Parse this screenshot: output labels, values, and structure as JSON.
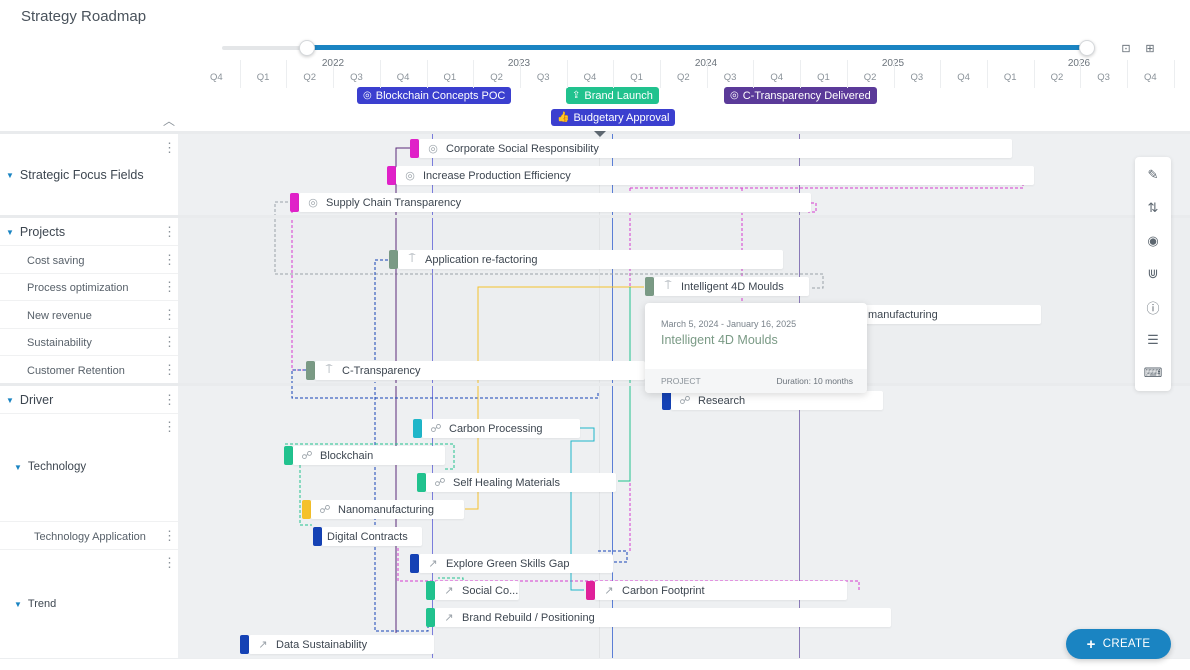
{
  "page": {
    "title": "Strategy Roadmap"
  },
  "slider": {
    "range_start": "2022 Q2",
    "range_end": "2026 Q2"
  },
  "header_tools": [
    {
      "name": "focus-icon",
      "glyph": "⊡"
    },
    {
      "name": "fit-view-icon",
      "glyph": "⊞"
    }
  ],
  "timeline": {
    "years": [
      "2022",
      "2023",
      "2024",
      "2025",
      "2026"
    ],
    "quarters": [
      "Q4",
      "Q1",
      "Q2",
      "Q3",
      "Q4",
      "Q1",
      "Q2",
      "Q3",
      "Q4",
      "Q1",
      "Q2",
      "Q3",
      "Q4",
      "Q1",
      "Q2",
      "Q3",
      "Q4",
      "Q1",
      "Q2",
      "Q3",
      "Q4"
    ]
  },
  "milestones": [
    {
      "label": "Blockchain Concepts POC",
      "icon": "brain-icon",
      "glyph": "◎",
      "color": "#3b3fcf"
    },
    {
      "label": "Brand Launch",
      "icon": "rocket-icon",
      "glyph": "⇪",
      "color": "#21c28e"
    },
    {
      "label": "Budgetary Approval",
      "icon": "thumbs-up-icon",
      "glyph": "👍",
      "color": "#3b3fcf"
    },
    {
      "label": "C-Transparency Delivered",
      "icon": "target-icon",
      "glyph": "◎",
      "color": "#5b3a99"
    }
  ],
  "rows": {
    "groups": [
      {
        "label": "Strategic Focus Fields"
      },
      {
        "label": "Projects",
        "children": [
          "Cost saving",
          "Process optimization",
          "New revenue",
          "Sustainability",
          "Customer Retention"
        ]
      },
      {
        "label": "Driver"
      },
      {
        "label": "Technology"
      },
      {
        "label": "Technology Application"
      },
      {
        "label": "Trend"
      }
    ]
  },
  "bars": [
    {
      "label": "Corporate Social Responsibility",
      "type": "focus-field",
      "color": "#e021c8"
    },
    {
      "label": "Increase Production Efficiency",
      "type": "focus-field",
      "color": "#e021c8"
    },
    {
      "label": "Supply Chain Transparency",
      "type": "focus-field",
      "color": "#e021c8"
    },
    {
      "label": "Application re-factoring",
      "type": "project",
      "color": "#7a9a85"
    },
    {
      "label": "Intelligent 4D Moulds",
      "type": "project",
      "color": "#7a9a85"
    },
    {
      "label": "manufacturing",
      "type": "project",
      "color": "#7a9a85"
    },
    {
      "label": "C-Transparency",
      "type": "project",
      "color": "#7a9a85"
    },
    {
      "label": "Research",
      "type": "technology",
      "color": "#1542b5"
    },
    {
      "label": "Carbon Processing",
      "type": "technology",
      "color": "#1fb6c9"
    },
    {
      "label": "Blockchain",
      "type": "technology",
      "color": "#21c28e"
    },
    {
      "label": "Self Healing Materials",
      "type": "technology",
      "color": "#21c28e"
    },
    {
      "label": "Nanomanufacturing",
      "type": "technology",
      "color": "#f5c12b"
    },
    {
      "label": "Digital Contracts",
      "type": "application",
      "color": "#1542b5"
    },
    {
      "label": "Explore Green Skills Gap",
      "type": "trend",
      "color": "#1542b5"
    },
    {
      "label": "Social Co...",
      "type": "trend",
      "color": "#21c28e"
    },
    {
      "label": "Carbon Footprint",
      "type": "trend",
      "color": "#e0219a"
    },
    {
      "label": "Brand Rebuild / Positioning",
      "type": "trend",
      "color": "#21c28e"
    },
    {
      "label": "Data Sustainability",
      "type": "trend",
      "color": "#1542b5"
    }
  ],
  "tooltip": {
    "dates": "March 5, 2024 - January 16, 2025",
    "title": "Intelligent 4D Moulds",
    "type": "PROJECT",
    "duration": "Duration: 10 months"
  },
  "side_toolbar": [
    {
      "name": "edit-icon",
      "glyph": "✎"
    },
    {
      "name": "sort-icon",
      "glyph": "⇅"
    },
    {
      "name": "eye-icon",
      "glyph": "◉"
    },
    {
      "name": "magnet-icon",
      "glyph": "⋓"
    },
    {
      "name": "info-icon",
      "glyph": "ⓘ"
    },
    {
      "name": "list-icon",
      "glyph": "☰"
    },
    {
      "name": "keyboard-icon",
      "glyph": "⌨"
    }
  ],
  "create_button": {
    "label": "CREATE",
    "glyph": "+"
  }
}
